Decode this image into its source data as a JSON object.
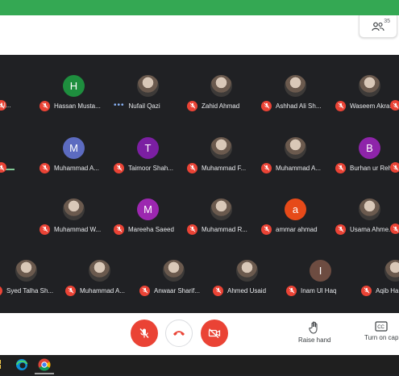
{
  "header": {
    "people_count": "35",
    "people_icon": "people-icon"
  },
  "colors": {
    "mic_off": "#ea4335",
    "active_speaker": "#81c995",
    "top_bar": "#34a853"
  },
  "edge": {
    "left_row1_label": "U..."
  },
  "participants": [
    {
      "name": "Hassan Musta...",
      "initial": "H",
      "color": "#1e8e3e",
      "avatar": "letter",
      "status": "muted"
    },
    {
      "name": "Nufail Qazi",
      "initial": "",
      "color": "#5f6368",
      "avatar": "photo",
      "status": "speaking"
    },
    {
      "name": "Zahid Ahmad",
      "initial": "",
      "color": "#5f6368",
      "avatar": "photo",
      "status": "muted"
    },
    {
      "name": "Ashhad Ali Sh...",
      "initial": "",
      "color": "#5f6368",
      "avatar": "photo",
      "status": "muted"
    },
    {
      "name": "Waseem Akra...",
      "initial": "",
      "color": "#5f6368",
      "avatar": "photo",
      "status": "muted"
    },
    {
      "name": "Muhammad A...",
      "initial": "M",
      "color": "#5c6bc0",
      "avatar": "letter",
      "status": "muted"
    },
    {
      "name": "Taimoor Shah...",
      "initial": "T",
      "color": "#7b1fa2",
      "avatar": "letter",
      "status": "muted"
    },
    {
      "name": "Muhammad F...",
      "initial": "",
      "color": "#5f6368",
      "avatar": "photo",
      "status": "muted"
    },
    {
      "name": "Muhammad A...",
      "initial": "",
      "color": "#5f6368",
      "avatar": "photo",
      "status": "muted"
    },
    {
      "name": "Burhan ur Reh...",
      "initial": "B",
      "color": "#8e24aa",
      "avatar": "letter",
      "status": "muted"
    },
    {
      "name": "Muhammad W...",
      "initial": "",
      "color": "#5f6368",
      "avatar": "photo",
      "status": "muted"
    },
    {
      "name": "Mareeha Saeed",
      "initial": "M",
      "color": "#9c27b0",
      "avatar": "letter",
      "status": "muted"
    },
    {
      "name": "Muhammad R...",
      "initial": "",
      "color": "#5f6368",
      "avatar": "photo",
      "status": "muted"
    },
    {
      "name": "ammar ahmad",
      "initial": "a",
      "color": "#e64a19",
      "avatar": "letter",
      "status": "muted"
    },
    {
      "name": "Usama Ahme...",
      "initial": "",
      "color": "#5f6368",
      "avatar": "photo",
      "status": "muted"
    },
    {
      "name": "Syed Talha Sh...",
      "initial": "",
      "color": "#5f6368",
      "avatar": "photo",
      "status": "muted"
    },
    {
      "name": "Muhammad A...",
      "initial": "",
      "color": "#5f6368",
      "avatar": "photo",
      "status": "muted"
    },
    {
      "name": "Anwaar Sharif...",
      "initial": "",
      "color": "#5f6368",
      "avatar": "photo",
      "status": "muted"
    },
    {
      "name": "Ahmed Usaid",
      "initial": "",
      "color": "#5f6368",
      "avatar": "photo",
      "status": "muted"
    },
    {
      "name": "Inam Ul Haq",
      "initial": "I",
      "color": "#6d4c41",
      "avatar": "letter",
      "status": "muted"
    },
    {
      "name": "Aqib Habib",
      "initial": "",
      "color": "#5f6368",
      "avatar": "photo",
      "status": "muted"
    }
  ],
  "controls": {
    "mic": "mic-off-icon",
    "hangup": "call-end-icon",
    "camera": "camera-off-icon",
    "raise_hand_label": "Raise hand",
    "captions_label": "Turn on cap"
  },
  "taskbar": {
    "icons": [
      "windows-icon",
      "edge-icon",
      "chrome-icon"
    ]
  }
}
